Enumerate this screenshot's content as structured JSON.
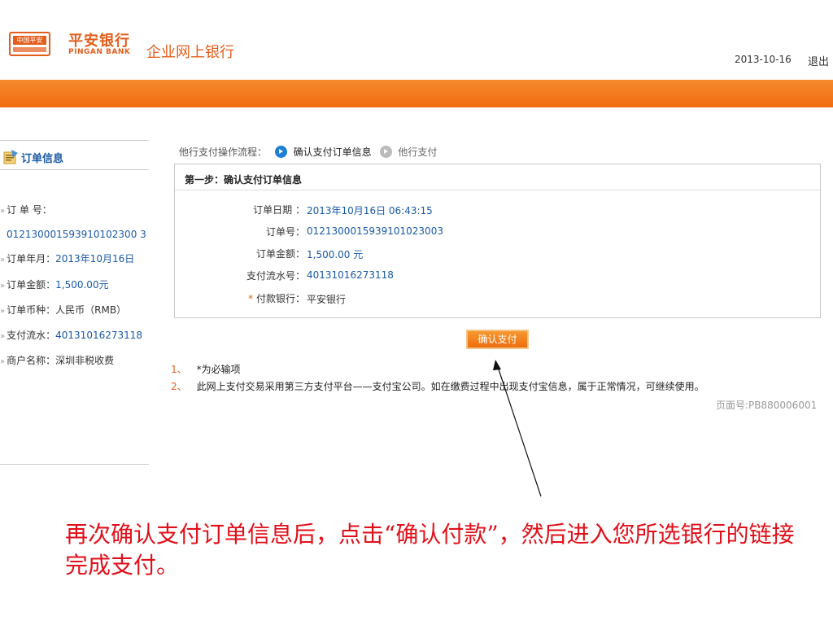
{
  "header": {
    "logo_badge_text": "中国平安",
    "brand_cn": "平安银行",
    "brand_en": "PINGAN BANK",
    "system_title": "企业网上银行",
    "date": "2013-10-16",
    "logout_label": "退出",
    "accent_color": "#e35d1c"
  },
  "sidebar": {
    "title": "订单信息",
    "icon": "order-info-icon",
    "items": [
      {
        "label": "订 单 号：",
        "value": ""
      },
      {
        "label": "",
        "value": "012130001593910102300 3"
      },
      {
        "label": "订单年月：",
        "value": "2013年10月16日"
      },
      {
        "label": "订单金额：",
        "value": "1,500.00元"
      },
      {
        "label": "订单币种：",
        "value": "人民币（RMB）"
      },
      {
        "label": "支付流水：",
        "value": "40131016273118"
      },
      {
        "label": "商户名称：",
        "value": "深圳非税收费"
      }
    ]
  },
  "flow": {
    "label": "他行支付操作流程：",
    "current_step": "确认支付订单信息",
    "next_step": "他行支付"
  },
  "panel": {
    "title": "第一步：确认支付订单信息",
    "rows": [
      {
        "label": "订单日期 ：",
        "value": "2013年10月16日 06:43:15"
      },
      {
        "label": "订单号：",
        "value": "0121300015939101023003"
      },
      {
        "label": "订单金额：",
        "value": "1,500.00 元"
      },
      {
        "label": "支付流水号：",
        "value": "40131016273118"
      },
      {
        "label": "付款银行：",
        "value": "平安银行",
        "required_mark": "*"
      }
    ]
  },
  "confirm_button_label": "确认支付",
  "notes": [
    {
      "num": "1、",
      "text": "*为必输项"
    },
    {
      "num": "2、",
      "text": "此网上支付交易采用第三方支付平台——支付宝公司。如在缴费过程中出现支付宝信息，属于正常情况，可继续使用。"
    }
  ],
  "page_number": "页面号:PB880006001",
  "caption": "再次确认支付订单信息后，点击“确认付款”，然后进入您所选银行的链接完成支付。"
}
